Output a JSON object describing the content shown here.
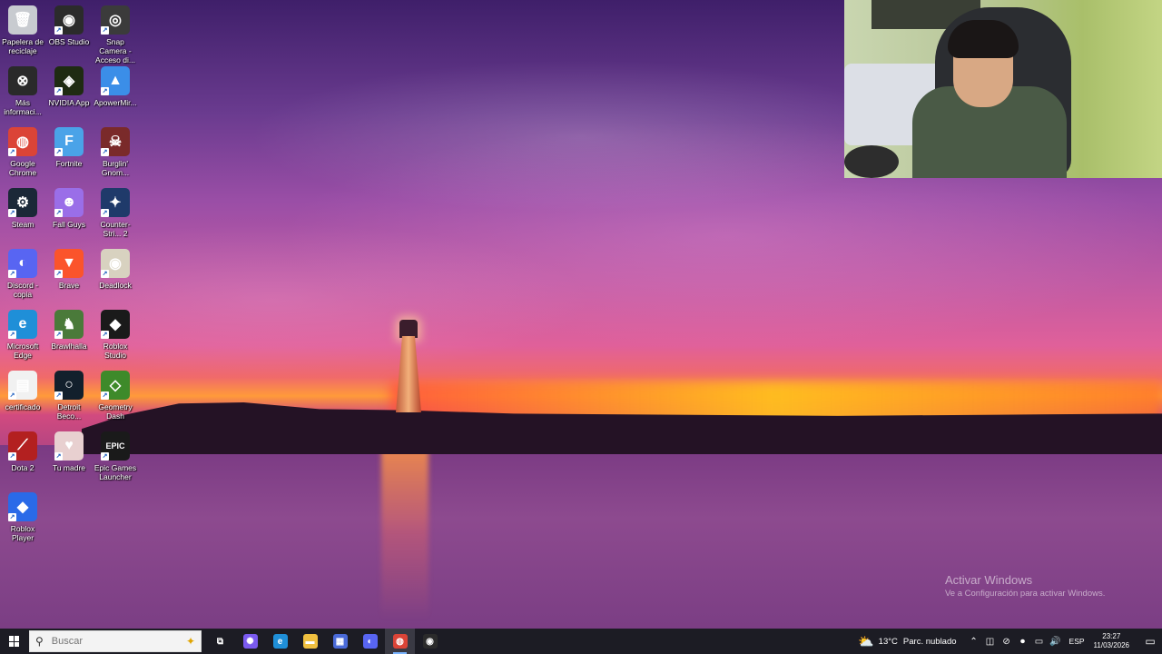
{
  "desktop_icons": [
    {
      "label": "Papelera de reciclaje",
      "icon": "recycle-bin-icon",
      "color": "#c8cbd0",
      "glyph": "🗑",
      "shortcut": false
    },
    {
      "label": "OBS Studio",
      "icon": "obs-icon",
      "color": "#2b2b2b",
      "glyph": "◉",
      "shortcut": true
    },
    {
      "label": "Snap Camera - Acceso di...",
      "icon": "snap-camera-icon",
      "color": "#3b3b3b",
      "glyph": "◎",
      "shortcut": true
    },
    {
      "label": "Más informaci...",
      "icon": "info-icon",
      "color": "#2a2a2a",
      "glyph": "⊗",
      "shortcut": false
    },
    {
      "label": "NVIDIA App",
      "icon": "nvidia-icon",
      "color": "#1f2b12",
      "glyph": "◈",
      "shortcut": true
    },
    {
      "label": "ApowerMir...",
      "icon": "apowermirror-icon",
      "color": "#3b8ee8",
      "glyph": "▲",
      "shortcut": true
    },
    {
      "label": "Google Chrome",
      "icon": "chrome-icon",
      "color": "#db4437",
      "glyph": "◍",
      "shortcut": true
    },
    {
      "label": "Fortnite",
      "icon": "fortnite-icon",
      "color": "#4aa3e8",
      "glyph": "F",
      "shortcut": true
    },
    {
      "label": "Burglin' Gnom...",
      "icon": "burglin-gnomes-icon",
      "color": "#7a2a2a",
      "glyph": "☠",
      "shortcut": true
    },
    {
      "label": "Steam",
      "icon": "steam-icon",
      "color": "#1b2838",
      "glyph": "⚙",
      "shortcut": true
    },
    {
      "label": "Fall Guys",
      "icon": "fall-guys-icon",
      "color": "#9a6ee8",
      "glyph": "☻",
      "shortcut": true
    },
    {
      "label": "Counter-Stri... 2",
      "icon": "counter-strike-icon",
      "color": "#1f3a6a",
      "glyph": "✦",
      "shortcut": true
    },
    {
      "label": "Discord - copia",
      "icon": "discord-icon",
      "color": "#5865f2",
      "glyph": "◐",
      "shortcut": true
    },
    {
      "label": "Brave",
      "icon": "brave-icon",
      "color": "#fb542b",
      "glyph": "▼",
      "shortcut": true
    },
    {
      "label": "Deadlock",
      "icon": "deadlock-icon",
      "color": "#d8d2c0",
      "glyph": "◉",
      "shortcut": true
    },
    {
      "label": "Microsoft Edge",
      "icon": "edge-icon",
      "color": "#1f8fd8",
      "glyph": "e",
      "shortcut": true
    },
    {
      "label": "Brawlhalla",
      "icon": "brawlhalla-icon",
      "color": "#4a7a3a",
      "glyph": "♞",
      "shortcut": true
    },
    {
      "label": "Roblox Studio",
      "icon": "roblox-studio-icon",
      "color": "#1a1a1a",
      "glyph": "◆",
      "shortcut": true
    },
    {
      "label": "certificado",
      "icon": "document-icon",
      "color": "#f1f1f1",
      "glyph": "▤",
      "shortcut": true
    },
    {
      "label": "Detroit Beco...",
      "icon": "detroit-icon",
      "color": "#12202c",
      "glyph": "○",
      "shortcut": true
    },
    {
      "label": "Geometry Dash",
      "icon": "geometry-dash-icon",
      "color": "#3e8a2a",
      "glyph": "◇",
      "shortcut": true
    },
    {
      "label": "Dota 2",
      "icon": "dota2-icon",
      "color": "#b32020",
      "glyph": "⟋",
      "shortcut": true
    },
    {
      "label": "Tu madre",
      "icon": "image-icon",
      "color": "#e8d0d0",
      "glyph": "♥",
      "shortcut": true
    },
    {
      "label": "Epic Games Launcher",
      "icon": "epic-games-icon",
      "color": "#1a1a1a",
      "glyph": "EPIC",
      "shortcut": true
    },
    {
      "label": "Roblox Player",
      "icon": "roblox-player-icon",
      "color": "#2a6ae8",
      "glyph": "◆",
      "shortcut": true
    }
  ],
  "watermark": {
    "title": "Activar Windows",
    "subtitle": "Ve a Configuración para activar Windows."
  },
  "taskbar": {
    "search_placeholder": "Buscar",
    "apps": [
      {
        "name": "task-view",
        "glyph": "⧉",
        "color": "transparent",
        "active": false
      },
      {
        "name": "copilot",
        "glyph": "✺",
        "color": "#7a5af0",
        "active": false
      },
      {
        "name": "edge",
        "glyph": "e",
        "color": "#1f8fd8",
        "active": false
      },
      {
        "name": "file-explorer",
        "glyph": "▬",
        "color": "#f0c040",
        "active": false
      },
      {
        "name": "microsoft-store",
        "glyph": "▦",
        "color": "#4a6ad8",
        "active": false
      },
      {
        "name": "discord",
        "glyph": "◐",
        "color": "#5865f2",
        "active": false
      },
      {
        "name": "chrome",
        "glyph": "◍",
        "color": "#db4437",
        "active": true
      },
      {
        "name": "obs",
        "glyph": "◉",
        "color": "#2b2b2b",
        "active": false
      }
    ],
    "weather": {
      "temp": "13°C",
      "condition": "Parc. nublado"
    },
    "language": "ESP",
    "time": "23:27",
    "date": "11/03/2026"
  }
}
